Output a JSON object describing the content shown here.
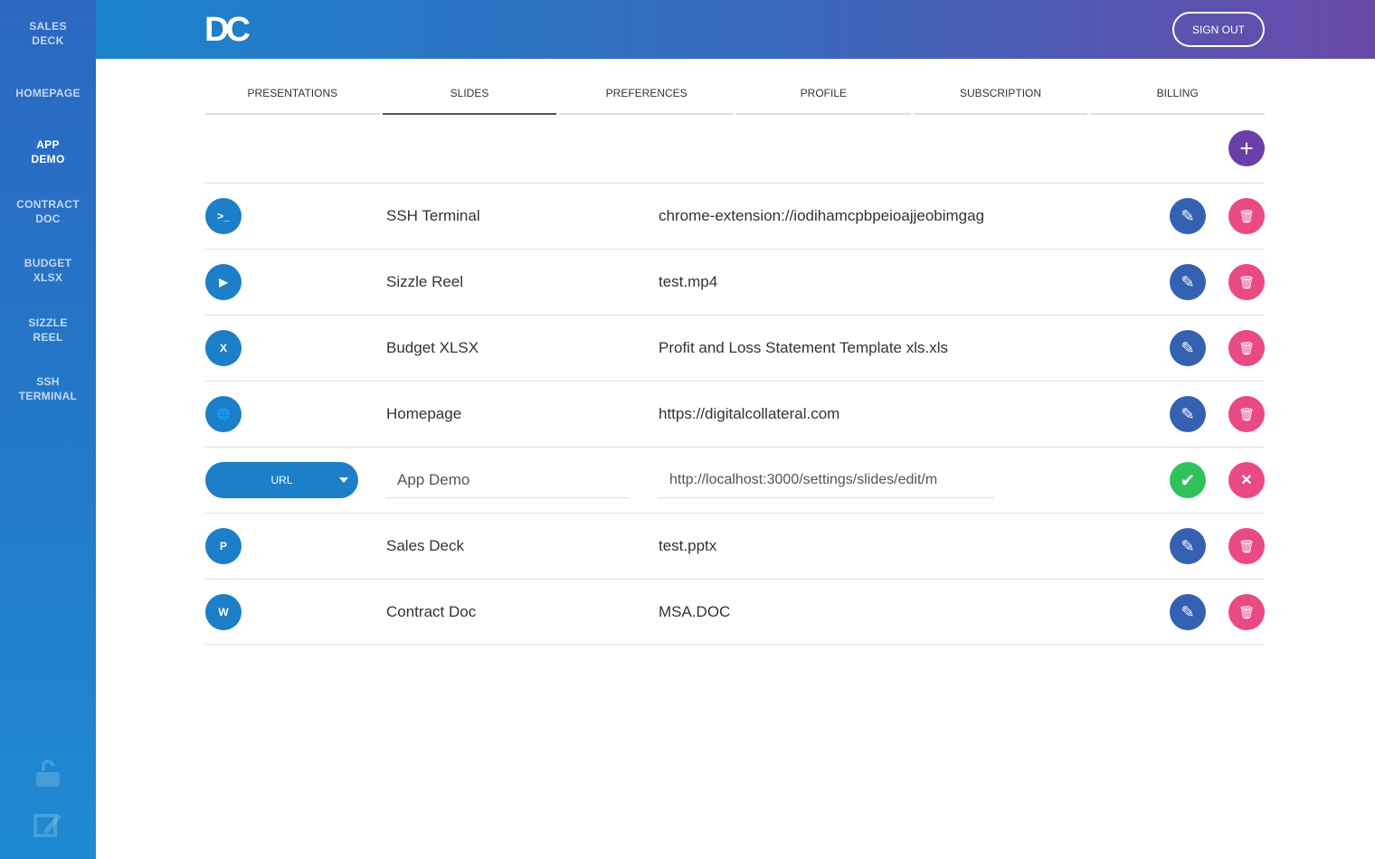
{
  "sidebar": {
    "items": [
      {
        "line1": "SALES",
        "line2": "DECK"
      },
      {
        "line1": "HOMEPAGE",
        "line2": ""
      },
      {
        "line1": "APP",
        "line2": "DEMO"
      },
      {
        "line1": "CONTRACT",
        "line2": "DOC"
      },
      {
        "line1": "BUDGET",
        "line2": "XLSX"
      },
      {
        "line1": "SIZZLE",
        "line2": "REEL"
      },
      {
        "line1": "SSH",
        "line2": "TERMINAL"
      }
    ]
  },
  "header": {
    "logo": "DC",
    "signout": "SIGN OUT"
  },
  "tabs": [
    "PRESENTATIONS",
    "SLIDES",
    "PREFERENCES",
    "PROFILE",
    "SUBSCRIPTION",
    "BILLING"
  ],
  "active_tab": "SLIDES",
  "add_label": "+",
  "rows": [
    {
      "icon": ">_",
      "name": "SSH Terminal",
      "value": "chrome-extension://iodihamcpbpeioajjeobimgag"
    },
    {
      "icon": "▶",
      "name": "Sizzle Reel",
      "value": "test.mp4"
    },
    {
      "icon": "X",
      "name": "Budget XLSX",
      "value": "Profit and Loss Statement Template xls.xls"
    },
    {
      "icon": "🌐",
      "name": "Homepage",
      "value": "https://digitalcollateral.com"
    },
    {
      "editing": true,
      "type": "URL",
      "name": "App Demo",
      "value": "http://localhost:3000/settings/slides/edit/m"
    },
    {
      "icon": "P",
      "name": "Sales Deck",
      "value": "test.pptx"
    },
    {
      "icon": "W",
      "name": "Contract Doc",
      "value": "MSA.DOC"
    }
  ],
  "glyphs": {
    "edit": "✎",
    "delete": "🗑",
    "confirm": "✔",
    "cancel": "✕"
  }
}
